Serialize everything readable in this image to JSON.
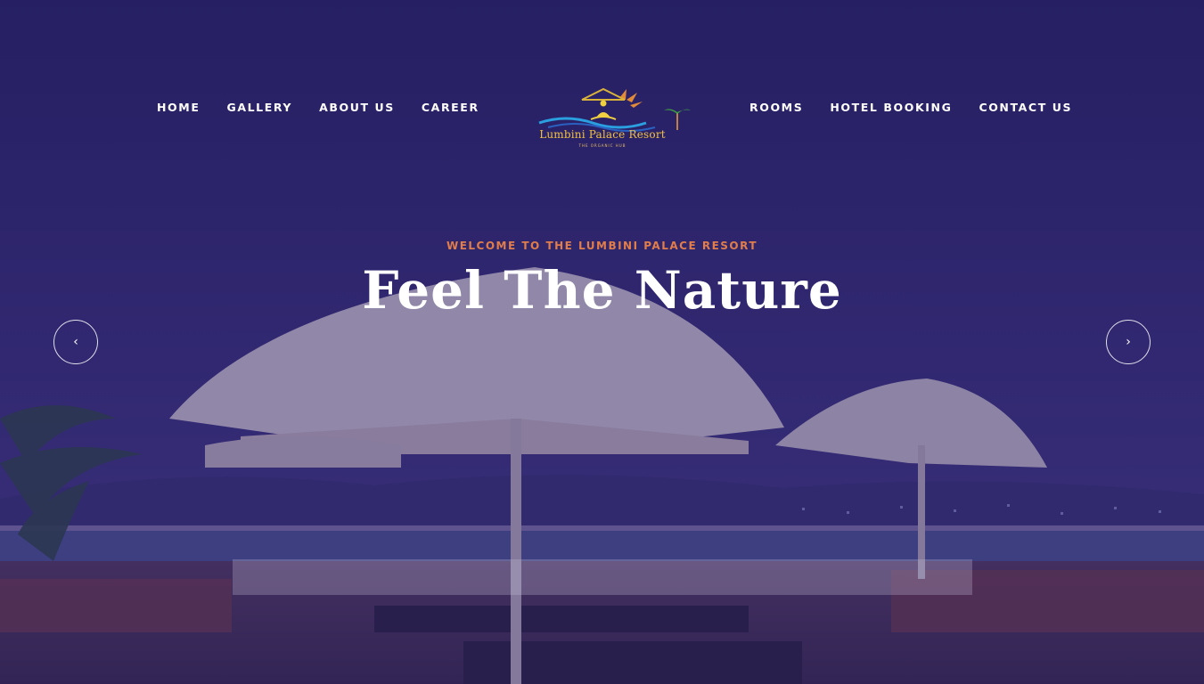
{
  "nav": {
    "left": [
      {
        "label": "HOME"
      },
      {
        "label": "GALLERY"
      },
      {
        "label": "ABOUT US"
      },
      {
        "label": "CAREER"
      }
    ],
    "right": [
      {
        "label": "ROOMS"
      },
      {
        "label": "HOTEL BOOKING"
      },
      {
        "label": "CONTACT US"
      }
    ]
  },
  "logo": {
    "name": "Lumbini Palace Resort",
    "tagline": "THE ORGANIC HUB"
  },
  "hero": {
    "welcome": "WELCOME TO THE LUMBINI PALACE RESORT",
    "headline": "Feel The Nature",
    "prev_glyph": "‹",
    "next_glyph": "›"
  },
  "colors": {
    "accent": "#e07d4a",
    "logo_gold": "#f0c040",
    "overlay": "#28206e"
  }
}
